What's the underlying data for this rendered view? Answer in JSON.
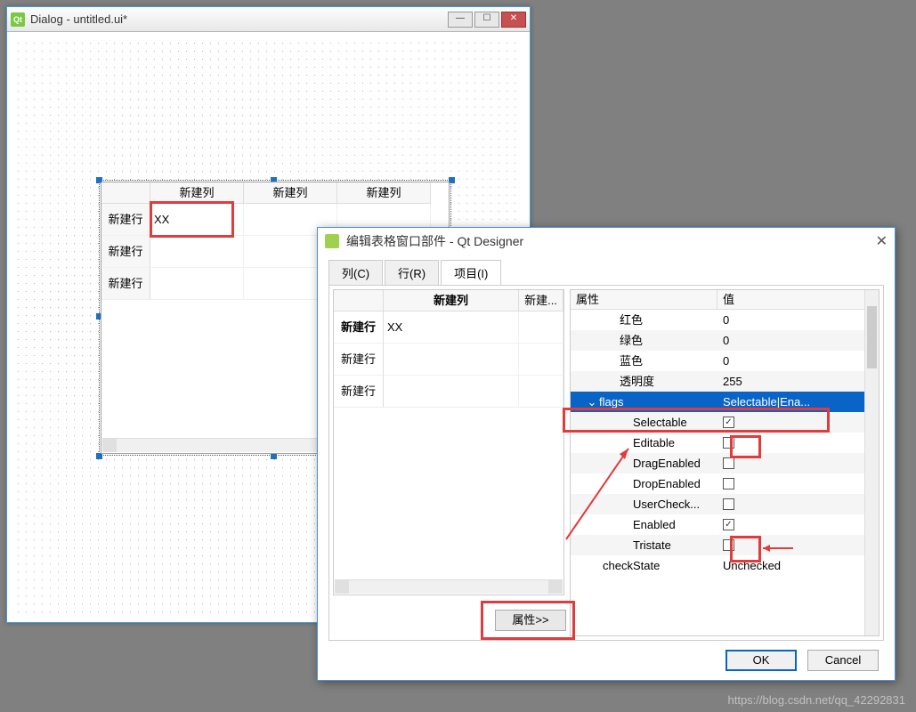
{
  "back_window": {
    "title": "Dialog - untitled.ui*",
    "icon_label": "Qt"
  },
  "table_widget": {
    "col_header": "新建列",
    "row_header": "新建行",
    "cell_value": "XX"
  },
  "front_dialog": {
    "title": "编辑表格窗口部件 - Qt Designer",
    "tabs": {
      "cols": "列(C)",
      "rows": "行(R)",
      "items": "项目(I)"
    },
    "prop_button": "属性>>",
    "left_table": {
      "col1": "新建列",
      "col2": "新建...",
      "rows": [
        "新建行",
        "新建行",
        "新建行"
      ],
      "cell_value": "XX"
    },
    "props": {
      "header_name": "属性",
      "header_val": "值",
      "red": {
        "name": "红色",
        "val": "0"
      },
      "green": {
        "name": "绿色",
        "val": "0"
      },
      "blue": {
        "name": "蓝色",
        "val": "0"
      },
      "alpha": {
        "name": "透明度",
        "val": "255"
      },
      "flags": {
        "name": "flags",
        "val": "Selectable|Ena..."
      },
      "selectable": {
        "name": "Selectable",
        "checked": true
      },
      "editable": {
        "name": "Editable",
        "checked": false
      },
      "dragenabled": {
        "name": "DragEnabled",
        "checked": false
      },
      "dropenabled": {
        "name": "DropEnabled",
        "checked": false
      },
      "usercheck": {
        "name": "UserCheck...",
        "checked": false
      },
      "enabled": {
        "name": "Enabled",
        "checked": true
      },
      "tristate": {
        "name": "Tristate",
        "checked": false
      },
      "checkstate": {
        "name": "checkState",
        "val": "Unchecked"
      }
    },
    "ok": "OK",
    "cancel": "Cancel"
  },
  "watermark": "https://blog.csdn.net/qq_42292831"
}
